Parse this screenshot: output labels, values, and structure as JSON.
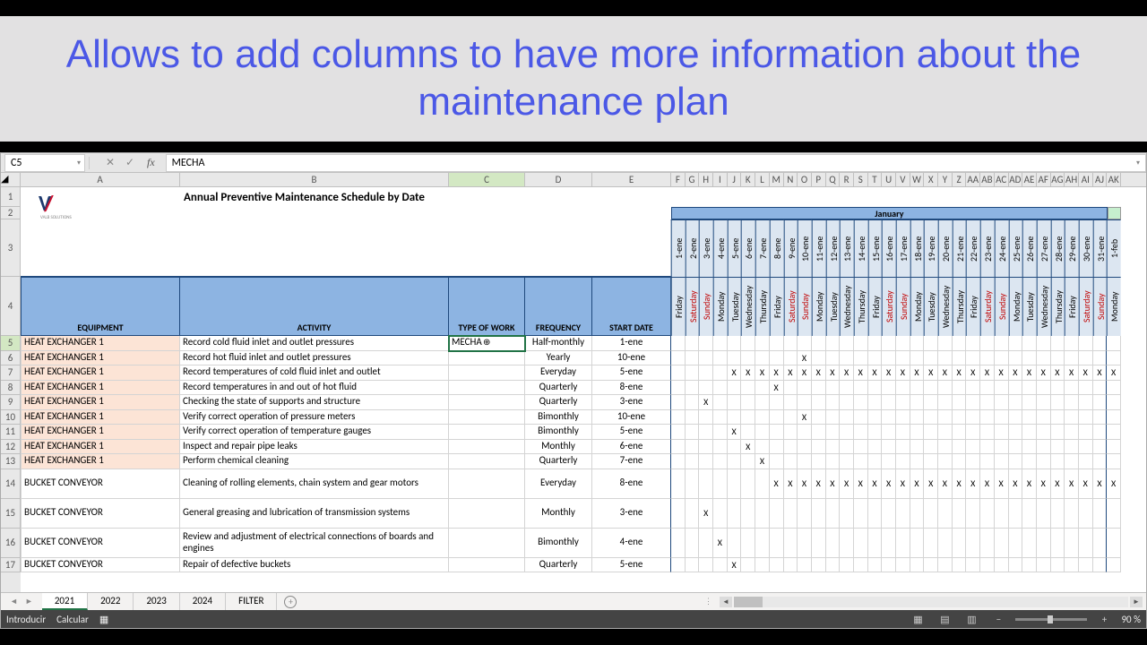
{
  "banner": "Allows to add columns to have more information about the maintenance plan",
  "nameBox": "C5",
  "formula": "MECHA",
  "title": "Annual Preventive Maintenance Schedule by Date",
  "logoSub": "VALB SOLUTIONS",
  "month": "January",
  "colLetters": [
    "A",
    "B",
    "C",
    "D",
    "E",
    "F",
    "G",
    "H",
    "I",
    "J",
    "K",
    "L",
    "M",
    "N",
    "O",
    "P",
    "Q",
    "R",
    "S",
    "T",
    "U",
    "V",
    "W",
    "X",
    "Y",
    "Z",
    "AA",
    "AB",
    "AC",
    "AD",
    "AE",
    "AF",
    "AG",
    "AH",
    "AI",
    "AJ",
    "AK"
  ],
  "dateLabels": [
    "1-ene",
    "2-ene",
    "3-ene",
    "4-ene",
    "5-ene",
    "6-ene",
    "7-ene",
    "8-ene",
    "9-ene",
    "10-ene",
    "11-ene",
    "12-ene",
    "13-ene",
    "14-ene",
    "15-ene",
    "16-ene",
    "17-ene",
    "18-ene",
    "19-ene",
    "20-ene",
    "21-ene",
    "22-ene",
    "23-ene",
    "24-ene",
    "25-ene",
    "26-ene",
    "27-ene",
    "28-ene",
    "29-ene",
    "30-ene",
    "31-ene",
    "1-feb"
  ],
  "dayLabels": [
    "Friday",
    "Saturday",
    "Sunday",
    "Monday",
    "Tuesday",
    "Wednesday",
    "Thursday",
    "Friday",
    "Saturday",
    "Sunday",
    "Monday",
    "Tuesday",
    "Wednesday",
    "Thursday",
    "Friday",
    "Saturday",
    "Sunday",
    "Monday",
    "Tuesday",
    "Wednesday",
    "Thursday",
    "Friday",
    "Saturday",
    "Sunday",
    "Monday",
    "Tuesday",
    "Wednesday",
    "Thursday",
    "Friday",
    "Saturday",
    "Sunday",
    "Monday"
  ],
  "weekend": [
    false,
    true,
    true,
    false,
    false,
    false,
    false,
    false,
    true,
    true,
    false,
    false,
    false,
    false,
    false,
    true,
    true,
    false,
    false,
    false,
    false,
    false,
    true,
    true,
    false,
    false,
    false,
    false,
    false,
    true,
    true,
    false
  ],
  "headers": {
    "equip": "EQUIPMENT",
    "act": "ACTIVITY",
    "type": "TYPE OF WORK",
    "freq": "FREQUENCY",
    "start": "START DATE"
  },
  "rows": [
    {
      "n": 5,
      "eq": "HEAT EXCHANGER 1",
      "act": "Record cold fluid inlet and outlet pressures",
      "type": "MECHA",
      "freq": "Half-monthly",
      "start": "1-ene",
      "sched": [],
      "sel": true,
      "cls": "equip1"
    },
    {
      "n": 6,
      "eq": "HEAT EXCHANGER 1",
      "act": "Record hot fluid inlet and outlet pressures",
      "type": "",
      "freq": "Yearly",
      "start": "10-ene",
      "sched": [
        9
      ],
      "cls": "equip1"
    },
    {
      "n": 7,
      "eq": "HEAT EXCHANGER 1",
      "act": "Record temperatures of cold fluid inlet and outlet",
      "type": "",
      "freq": "Everyday",
      "start": "5-ene",
      "sched": [
        4,
        5,
        6,
        7,
        8,
        9,
        10,
        11,
        12,
        13,
        14,
        15,
        16,
        17,
        18,
        19,
        20,
        21,
        22,
        23,
        24,
        25,
        26,
        27,
        28,
        29,
        30,
        31
      ],
      "cls": "equip1"
    },
    {
      "n": 8,
      "eq": "HEAT EXCHANGER 1",
      "act": "Record temperatures in and out of hot fluid",
      "type": "",
      "freq": "Quarterly",
      "start": "8-ene",
      "sched": [
        7
      ],
      "cls": "equip1"
    },
    {
      "n": 9,
      "eq": "HEAT EXCHANGER 1",
      "act": "Checking the state of supports and structure",
      "type": "",
      "freq": "Quarterly",
      "start": "3-ene",
      "sched": [
        2
      ],
      "cls": "equip1"
    },
    {
      "n": 10,
      "eq": "HEAT EXCHANGER 1",
      "act": "Verify correct operation of pressure meters",
      "type": "",
      "freq": "Bimonthly",
      "start": "10-ene",
      "sched": [
        9
      ],
      "cls": "equip1"
    },
    {
      "n": 11,
      "eq": "HEAT EXCHANGER 1",
      "act": "Verify correct operation of temperature gauges",
      "type": "",
      "freq": "Bimonthly",
      "start": "5-ene",
      "sched": [
        4
      ],
      "cls": "equip1"
    },
    {
      "n": 12,
      "eq": "HEAT EXCHANGER 1",
      "act": "Inspect and repair pipe leaks",
      "type": "",
      "freq": "Monthly",
      "start": "6-ene",
      "sched": [
        5
      ],
      "cls": "equip1"
    },
    {
      "n": 13,
      "eq": "HEAT EXCHANGER 1",
      "act": "Perform chemical cleaning",
      "type": "",
      "freq": "Quarterly",
      "start": "7-ene",
      "sched": [
        6
      ],
      "cls": "equip1"
    },
    {
      "n": 14,
      "eq": "BUCKET CONVEYOR",
      "act": "Cleaning of rolling elements, chain system and gear motors",
      "type": "",
      "freq": "Everyday",
      "start": "8-ene",
      "sched": [
        7,
        8,
        9,
        10,
        11,
        12,
        13,
        14,
        15,
        16,
        17,
        18,
        19,
        20,
        21,
        22,
        23,
        24,
        25,
        26,
        27,
        28,
        29,
        30,
        31
      ],
      "tall": true,
      "cls": "equip2"
    },
    {
      "n": 15,
      "eq": "BUCKET CONVEYOR",
      "act": "General greasing and lubrication of transmission systems",
      "type": "",
      "freq": "Monthly",
      "start": "3-ene",
      "sched": [
        2
      ],
      "tall": true,
      "cls": "equip2"
    },
    {
      "n": 16,
      "eq": "BUCKET CONVEYOR",
      "act": "Review and adjustment of electrical connections of boards and engines",
      "type": "",
      "freq": "Bimonthly",
      "start": "4-ene",
      "sched": [
        3
      ],
      "tall": true,
      "cls": "equip2"
    },
    {
      "n": 17,
      "eq": "BUCKET CONVEYOR",
      "act": "Repair of defective buckets",
      "type": "",
      "freq": "Quarterly",
      "start": "5-ene",
      "sched": [
        4
      ],
      "cls": "equip2"
    }
  ],
  "tabs": [
    "2021",
    "2022",
    "2023",
    "2024",
    "FILTER"
  ],
  "activeTab": 0,
  "status": {
    "left1": "Introducir",
    "left2": "Calcular",
    "zoom": "90 %"
  }
}
